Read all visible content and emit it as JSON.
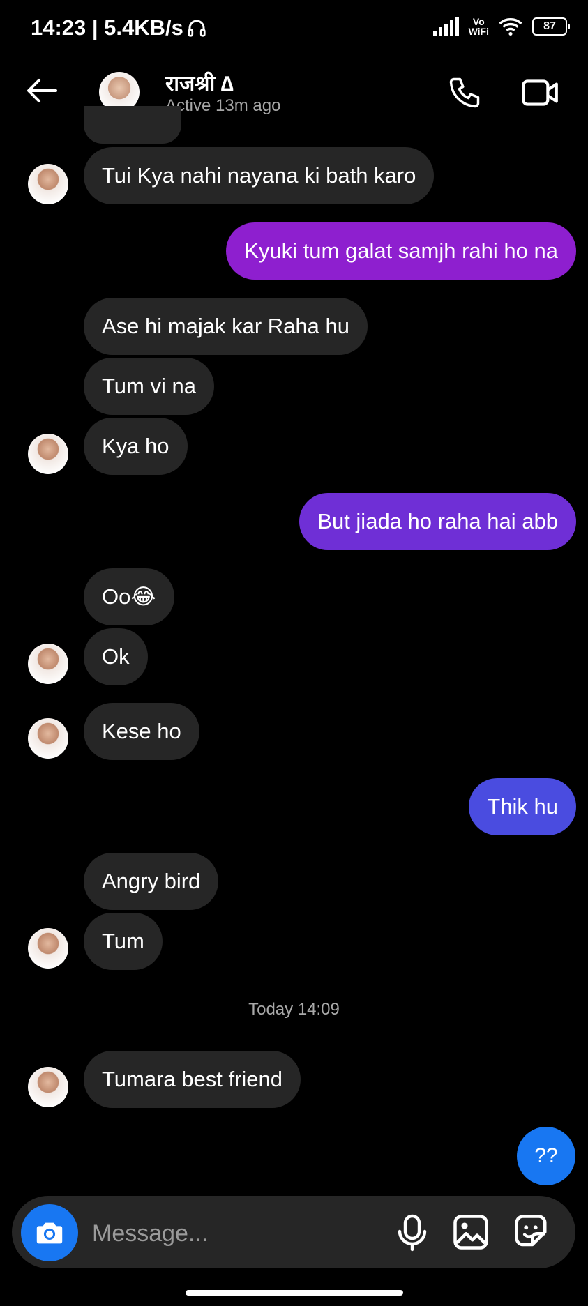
{
  "status_bar": {
    "time_speed": "14:23 | 5.4KB/s",
    "vowifi_top": "Vo",
    "vowifi_bottom": "WiFi",
    "battery": "87"
  },
  "header": {
    "name": "राजश्री ∆",
    "status": "Active 13m ago"
  },
  "messages": [
    {
      "text": "Tui Kya nahi nayana ki bath karo"
    },
    {
      "text": "Kyuki tum galat samjh rahi ho na",
      "color": "#8e1fcf"
    },
    {
      "text": "Ase hi majak kar Raha hu"
    },
    {
      "text": "Tum vi na"
    },
    {
      "text": "Kya ho"
    },
    {
      "text": "But jiada ho raha hai abb",
      "color": "#6f2fd6"
    },
    {
      "text": "Oo😂"
    },
    {
      "text": "Ok"
    },
    {
      "text": "Kese ho"
    },
    {
      "text": "Thik hu",
      "color": "#4a4ce0"
    },
    {
      "text": "Angry bird"
    },
    {
      "text": "Tum"
    },
    {
      "text": "Tumara best friend"
    }
  ],
  "timestamp": "Today 14:09",
  "fab_label": "??",
  "composer": {
    "placeholder": "Message..."
  },
  "colors": {
    "incoming_bubble": "#262626",
    "accent_blue": "#1877f2"
  },
  "icons": [
    "back-arrow-icon",
    "phone-icon",
    "video-camera-icon",
    "camera-icon",
    "microphone-icon",
    "gallery-icon",
    "sticker-icon"
  ]
}
